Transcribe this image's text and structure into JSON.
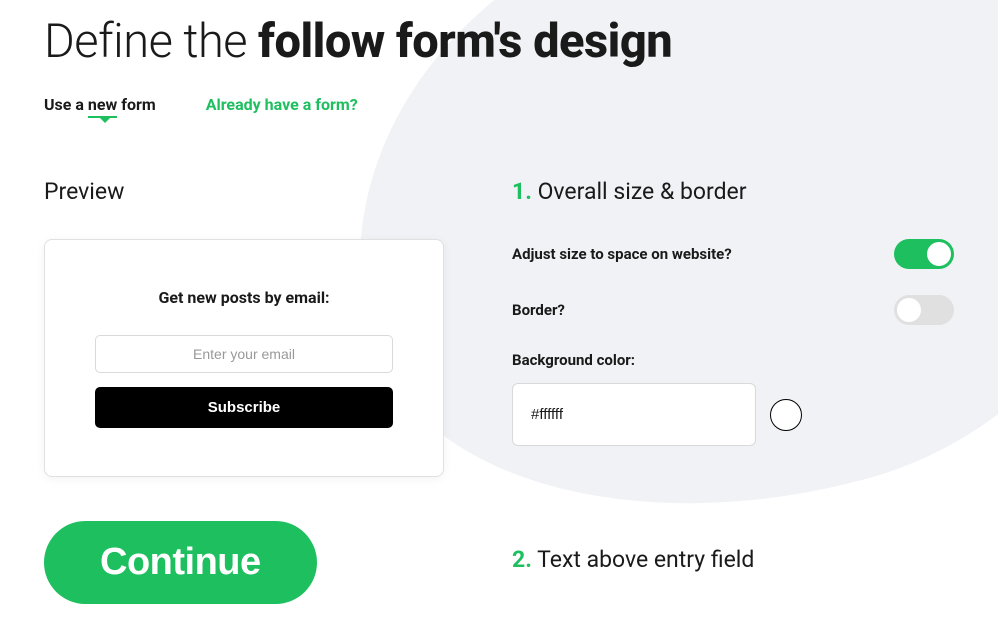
{
  "title": {
    "light": "Define the ",
    "bold": "follow form's design"
  },
  "tabs": {
    "active_prefix": "Use a ",
    "active_underline": "new",
    "active_suffix": " form",
    "secondary": "Already have a form?"
  },
  "preview": {
    "title": "Preview",
    "heading": "Get new posts by email:",
    "placeholder": "Enter your email",
    "button": "Subscribe"
  },
  "continue": "Continue",
  "section1": {
    "num": "1.",
    "title": "Overall size & border",
    "adjust_label": "Adjust size to space on website?",
    "adjust_on": true,
    "border_label": "Border?",
    "border_on": false,
    "bg_color_label": "Background color:",
    "bg_color_value": "#ffffff"
  },
  "section2": {
    "num": "2.",
    "title": "Text above entry field"
  }
}
